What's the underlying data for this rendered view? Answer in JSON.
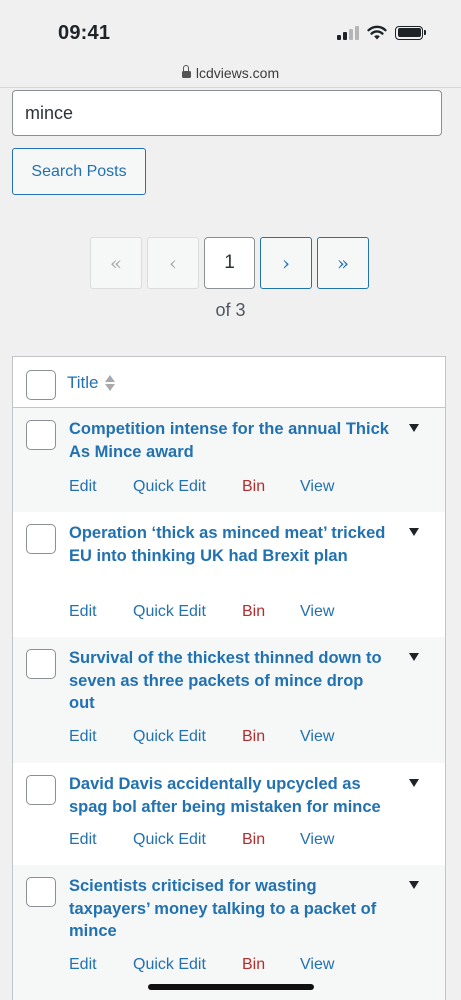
{
  "status_bar": {
    "time": "09:41"
  },
  "browser": {
    "url": "lcdviews.com"
  },
  "search": {
    "value": "mince",
    "button_label": "Search Posts"
  },
  "pagination": {
    "first": "«",
    "prev": "‹",
    "current": "1",
    "next": "›",
    "last": "»",
    "of_label": "of 3"
  },
  "table": {
    "header_title": "Title",
    "actions": {
      "edit": "Edit",
      "quick_edit": "Quick Edit",
      "bin": "Bin",
      "view": "View"
    },
    "rows": [
      {
        "title": "Competition intense for the annual Thick As Mince award"
      },
      {
        "title": "Operation ‘thick as minced meat’ tricked EU into thinking UK had Brexit plan"
      },
      {
        "title": "Survival of the thickest thinned down to seven as three packets of mince drop out"
      },
      {
        "title": "David Davis accidentally upcycled as spag bol after being mistaken for mince"
      },
      {
        "title": "Scientists criticised for wasting taxpayers’ money talking to a packet of mince"
      }
    ]
  },
  "colors": {
    "link": "#2271b1",
    "delete": "#b32d2e",
    "background": "#f0f0f1"
  }
}
